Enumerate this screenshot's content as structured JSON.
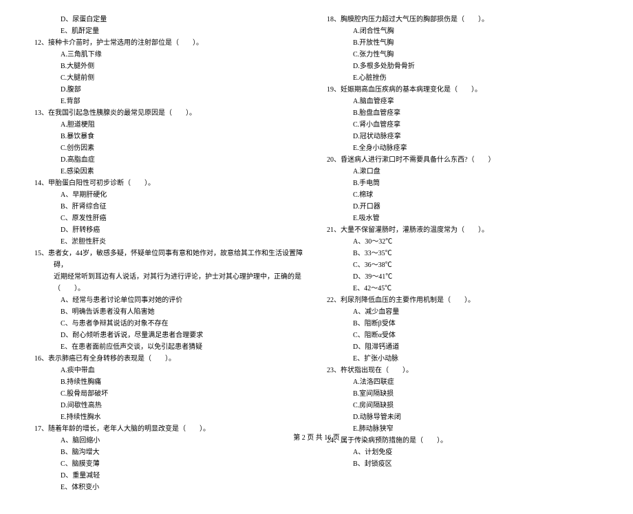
{
  "left": {
    "q11_opts": {
      "D": "D、尿蛋白定量",
      "E": "E、肌酐定量"
    },
    "q12": {
      "text": "12、接种卡介苗时，护士常选用的注射部位是（　　）。",
      "A": "A.三角肌下缘",
      "B": "B.大腿外侧",
      "C": "C.大腿前侧",
      "D": "D.腹部",
      "E": "E.背部"
    },
    "q13": {
      "text": "13、在我国引起急性胰腺炎的最常见原因是（　　）。",
      "A": "A.胆道梗阻",
      "B": "B.暴饮暴食",
      "C": "C.创伤因素",
      "D": "D.高脂血症",
      "E": "E.感染因素"
    },
    "q14": {
      "text": "14、甲胎蛋白阳性可初步诊断（　　）。",
      "A": "A、早期肝硬化",
      "B": "B、肝肾综合征",
      "C": "C、原发性肝癌",
      "D": "D、肝转移癌",
      "E": "E、淤胆性肝炎"
    },
    "q15": {
      "text1": "15、患者女，44岁，敏感多疑，怀疑单位同事有意和她作对，故意给其工作和生活设置障碍，",
      "text2": "近期经常听到耳边有人说话，对其行为进行评论，护士对其心理护理中，正确的是（　　）。",
      "A": "A、经常与患者讨论单位同事对她的评价",
      "B": "B、明确告诉患者没有人陷害她",
      "C": "C、与患者争辩其说话的对象不存在",
      "D": "D、耐心倾听患者诉说，尽量满足患者合理要求",
      "E": "E、在患者面前应低声交谈，以免引起患者猜疑"
    },
    "q16": {
      "text": "16、表示肺癌已有全身转移的表现是（　　）。",
      "A": "A.痰中带血",
      "B": "B.持续性胸痛",
      "C": "C.股骨局部破坏",
      "D": "D.间歇性高热",
      "E": "E.持续性胸水"
    },
    "q17": {
      "text": "17、随着年龄的增长，老年人大脑的明显改变是（　　）。",
      "A": "A、脑回缩小",
      "B": "B、脑沟增大",
      "C": "C、脑膜变薄",
      "D": "D、重量减轻",
      "E": "E、体积变小"
    }
  },
  "right": {
    "q18": {
      "text": "18、胸膜腔内压力超过大气压的胸部损伤是（　　）。",
      "A": "A.闭合性气胸",
      "B": "B.开放性气胸",
      "C": "C.张力性气胸",
      "D": "D.多根多处肋骨骨折",
      "E": "E.心脏挫伤"
    },
    "q19": {
      "text": "19、妊娠期高血压疾病的基本病理变化是（　　）。",
      "A": "A.脑血管痉挛",
      "B": "B.胎盘血管痉挛",
      "C": "C.肾小血管痉挛",
      "D": "D.冠状动脉痉挛",
      "E": "E.全身小动脉痉挛"
    },
    "q20": {
      "text": "20、昏迷病人进行漱口时不需要具备什么东西?（　　）",
      "A": "A.漱口盘",
      "B": "B.手电筒",
      "C": "C.棉球",
      "D": "D.开口器",
      "E": "E.吸水管"
    },
    "q21": {
      "text": "21、大量不保留灌肠时，灌肠液的温度常为（　　）。",
      "A": "A、30～32℃",
      "B": "B、33～35℃",
      "C": "C、36～38℃",
      "D": "D、39～41℃",
      "E": "E、42～45℃"
    },
    "q22": {
      "text": "22、利尿剂降低血压的主要作用机制是（　　）。",
      "A": "A、减少血容量",
      "B": "B、阻断β受体",
      "C": "C、阻断α受体",
      "D": "D、阻滞钙通道",
      "E": "E、扩张小动脉"
    },
    "q23": {
      "text": "23、杵状指出现在（　　）。",
      "A": "A.法洛四联症",
      "B": "B.室间隔缺损",
      "C": "C.房间隔缺损",
      "D": "D.动脉导管未闭",
      "E": "E.肺动脉狭窄"
    },
    "q24": {
      "text": "24、属于传染病预防措施的是（　　）。",
      "A": "A、计划免疫",
      "B": "B、封锁疫区"
    }
  },
  "footer": "第 2 页 共 16 页"
}
